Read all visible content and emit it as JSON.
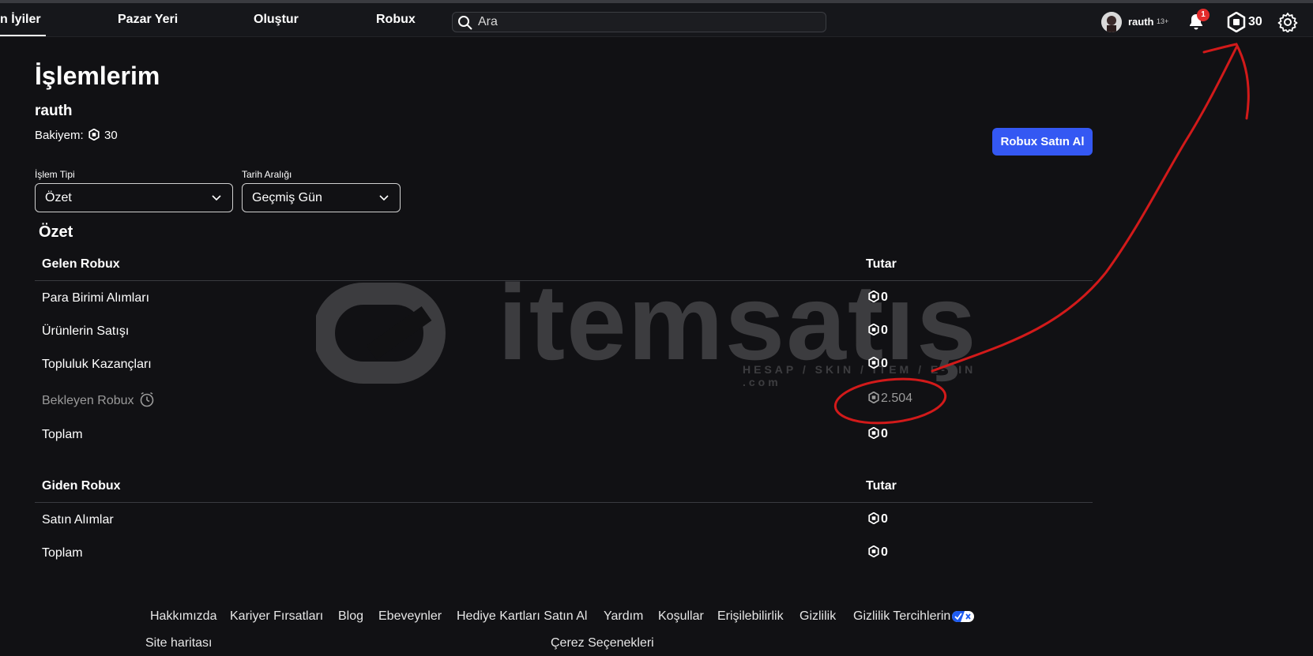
{
  "nav": {
    "items": [
      "n İyiler",
      "Pazar Yeri",
      "Oluştur",
      "Robux"
    ],
    "search_placeholder": "Ara",
    "username": "rauth",
    "age_badge": "13+",
    "notification_count": "1",
    "robux_count": "30"
  },
  "page": {
    "title": "İşlemlerim",
    "username": "rauth",
    "balance_label": "Bakiyem:",
    "balance_value": "30",
    "buy_button": "Robux Satın Al"
  },
  "filters": {
    "type_label": "İşlem Tipi",
    "type_value": "Özet",
    "date_label": "Tarih Aralığı",
    "date_value": "Geçmiş Gün"
  },
  "summary": {
    "title": "Özet",
    "incoming": {
      "header": "Gelen Robux",
      "amount_header": "Tutar",
      "rows": [
        {
          "label": "Para Birimi Alımları",
          "amount": "0"
        },
        {
          "label": "Ürünlerin Satışı",
          "amount": "0"
        },
        {
          "label": "Topluluk Kazançları",
          "amount": "0"
        },
        {
          "label": "Bekleyen Robux",
          "amount": "2.504"
        },
        {
          "label": "Toplam",
          "amount": "0"
        }
      ]
    },
    "outgoing": {
      "header": "Giden Robux",
      "amount_header": "Tutar",
      "rows": [
        {
          "label": "Satın Alımlar",
          "amount": "0"
        },
        {
          "label": "Toplam",
          "amount": "0"
        }
      ]
    }
  },
  "footer": {
    "links": [
      "Hakkımızda",
      "Kariyer Fırsatları",
      "Blog",
      "Ebeveynler",
      "Hediye Kartları Satın Al",
      "Yardım",
      "Koşullar",
      "Erişilebilirlik",
      "Gizlilik",
      "Gizlilik Tercihlerin"
    ],
    "links2": [
      "Site haritası",
      "Çerez Seçenekleri"
    ]
  },
  "watermark": {
    "text": "itemsatış",
    "subtext": "HESAP / SKIN / ITEM / E-PIN .com"
  },
  "colors": {
    "background": "#111114",
    "accent_button": "#3458f3",
    "notification": "#e22b2b",
    "annotation": "#d21a1a"
  }
}
